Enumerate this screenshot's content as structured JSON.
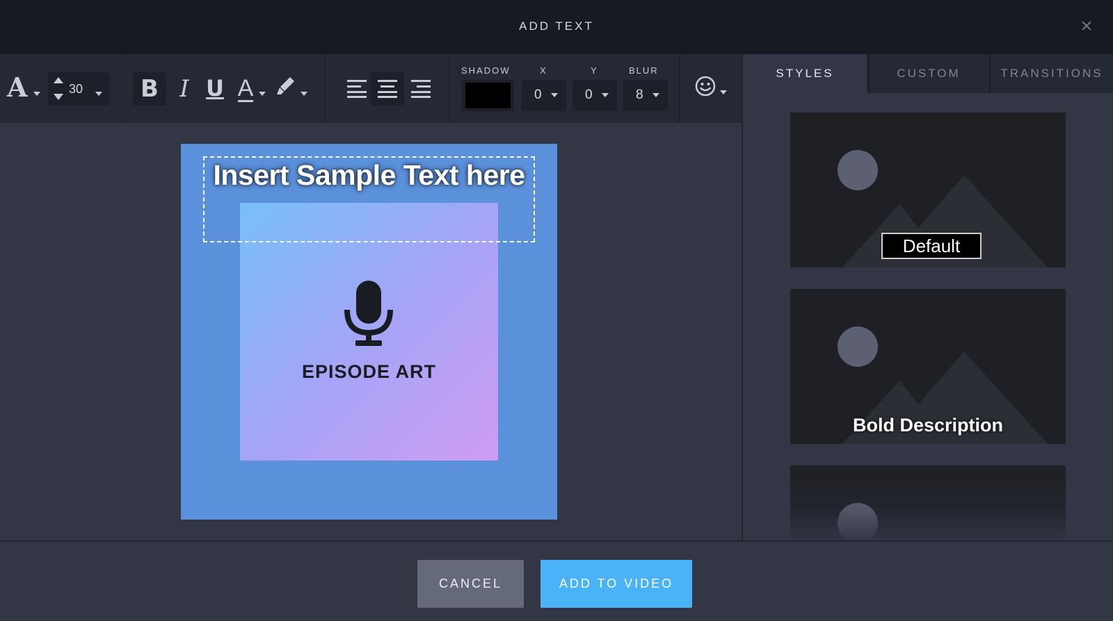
{
  "header": {
    "title": "ADD TEXT",
    "close_icon": "close-icon"
  },
  "toolbar": {
    "font_size": "30",
    "bold_label": "B",
    "italic_label": "I",
    "underline_label": "U",
    "font_label": "A",
    "color_label": "A",
    "shadow": {
      "label": "SHADOW",
      "color": "#000000",
      "x_label": "X",
      "x_value": "0",
      "y_label": "Y",
      "y_value": "0",
      "blur_label": "BLUR",
      "blur_value": "8"
    },
    "align_active": "center"
  },
  "canvas": {
    "sample_text": "Insert Sample Text here",
    "art_label": "EPISODE ART",
    "frame_color": "#5b91db"
  },
  "panel": {
    "tabs": [
      {
        "label": "STYLES",
        "active": true
      },
      {
        "label": "CUSTOM",
        "active": false
      },
      {
        "label": "TRANSITIONS",
        "active": false
      }
    ],
    "styles": [
      {
        "label": "Default"
      },
      {
        "label": "Bold Description"
      }
    ]
  },
  "footer": {
    "cancel_label": "CANCEL",
    "add_label": "ADD TO VIDEO"
  },
  "colors": {
    "header_bg": "#171a21",
    "accent": "#4ab2f7",
    "cancel_bg": "#646a7c"
  }
}
